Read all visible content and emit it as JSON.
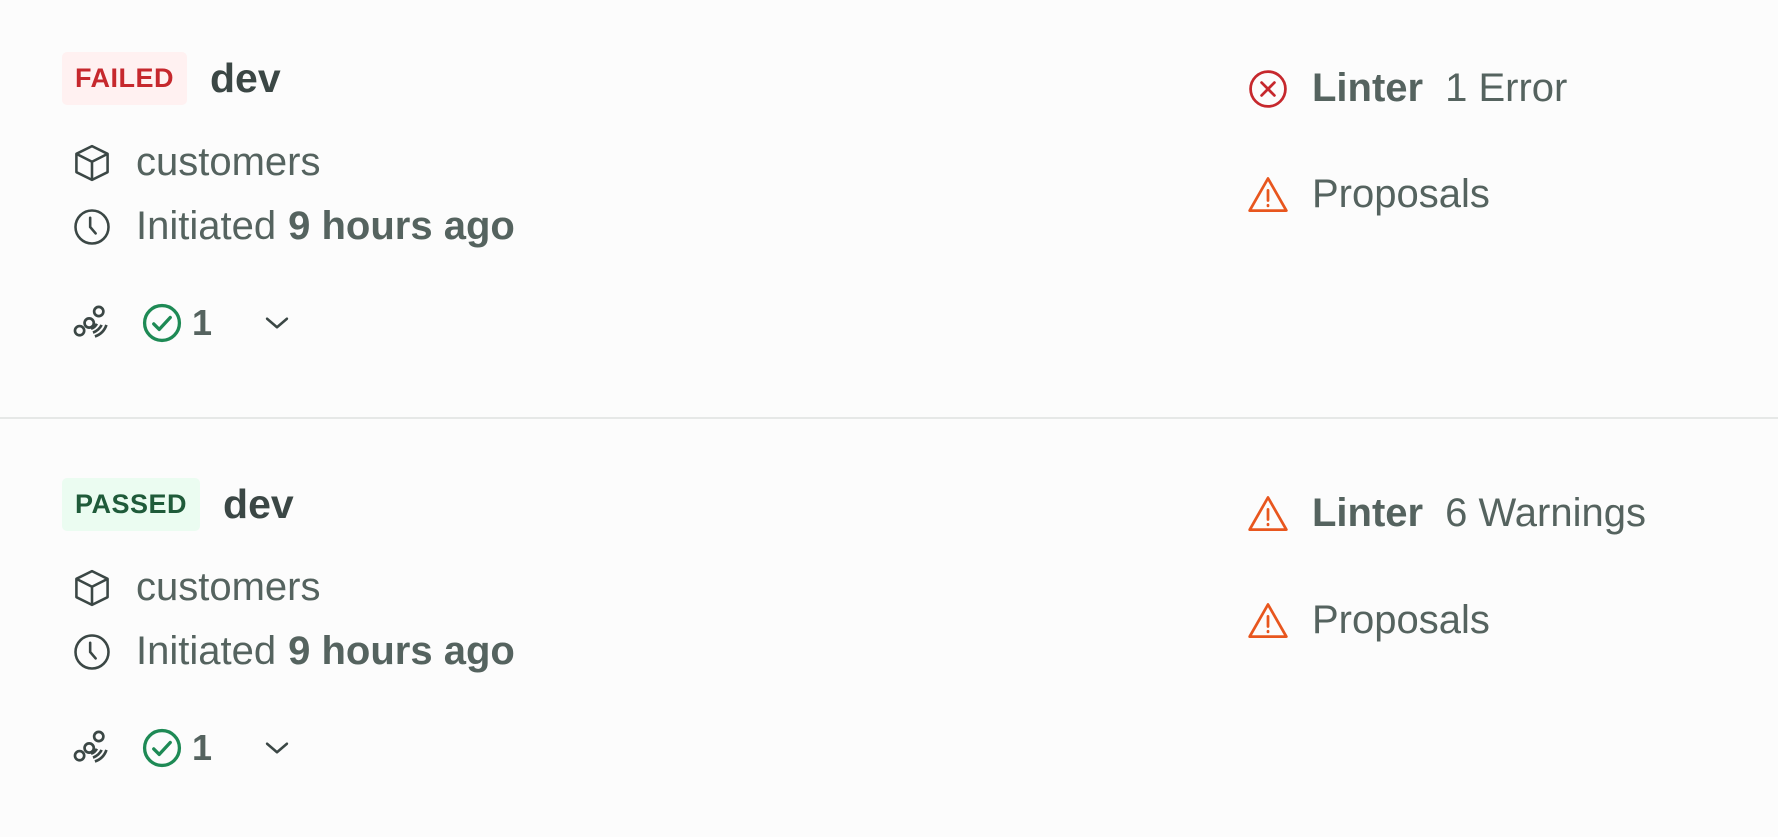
{
  "runs": [
    {
      "status": "FAILED",
      "environment": "dev",
      "resource": "customers",
      "initiated_prefix": "Initiated",
      "initiated_time": "9 hours ago",
      "passed_checks": "1",
      "checks": {
        "linter": {
          "label": "Linter",
          "result": "1 Error",
          "icon": "error-circle-icon"
        },
        "proposals": {
          "label": "Proposals",
          "icon": "warning-triangle-icon"
        }
      }
    },
    {
      "status": "PASSED",
      "environment": "dev",
      "resource": "customers",
      "initiated_prefix": "Initiated",
      "initiated_time": "9 hours ago",
      "passed_checks": "1",
      "checks": {
        "linter": {
          "label": "Linter",
          "result": "6 Warnings",
          "icon": "warning-triangle-icon"
        },
        "proposals": {
          "label": "Proposals",
          "icon": "warning-triangle-icon"
        }
      }
    }
  ],
  "colors": {
    "failed": "#c6282d",
    "failed_bg": "#fff1f1",
    "passed": "#1f5b3a",
    "passed_bg": "#ebfcf1",
    "success": "#1e8a55",
    "warning": "#e8561e",
    "error": "#c6282d",
    "text": "#55635f"
  }
}
